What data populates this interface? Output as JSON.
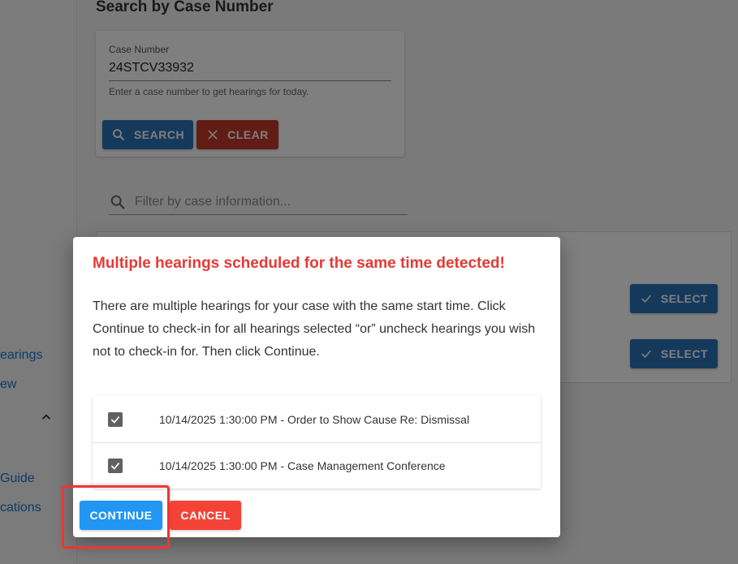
{
  "sidebar": {
    "items": [
      {
        "label": "earings"
      },
      {
        "label": "ew"
      },
      {
        "label": "Guide"
      },
      {
        "label": "cations"
      }
    ]
  },
  "search_section": {
    "title": "Search by Case Number",
    "case_number_label": "Case Number",
    "case_number_value": "24STCV33932",
    "hint": "Enter a case number to get hearings for today.",
    "search_label": "SEARCH",
    "clear_label": "CLEAR"
  },
  "filter": {
    "placeholder": "Filter by case information..."
  },
  "results": {
    "select_label": "SELECT"
  },
  "dialog": {
    "title": "Multiple hearings scheduled for the same time detected!",
    "body": "There are multiple hearings for your case with the same start time. Click Continue to check-in for all hearings selected “or” uncheck hearings you wish not to check-in for. Then click Continue.",
    "hearings": [
      {
        "label": "10/14/2025 1:30:00 PM - Order to Show Cause Re: Dismissal",
        "checked": true
      },
      {
        "label": "10/14/2025 1:30:00 PM - Case Management Conference",
        "checked": true
      }
    ],
    "continue_label": "CONTINUE",
    "cancel_label": "CANCEL"
  },
  "colors": {
    "primary": "#2b73b6",
    "danger": "#c0392b",
    "dialog_title": "#e53935",
    "continue": "#2196f3",
    "cancel": "#f44336",
    "highlight": "#e53935"
  }
}
